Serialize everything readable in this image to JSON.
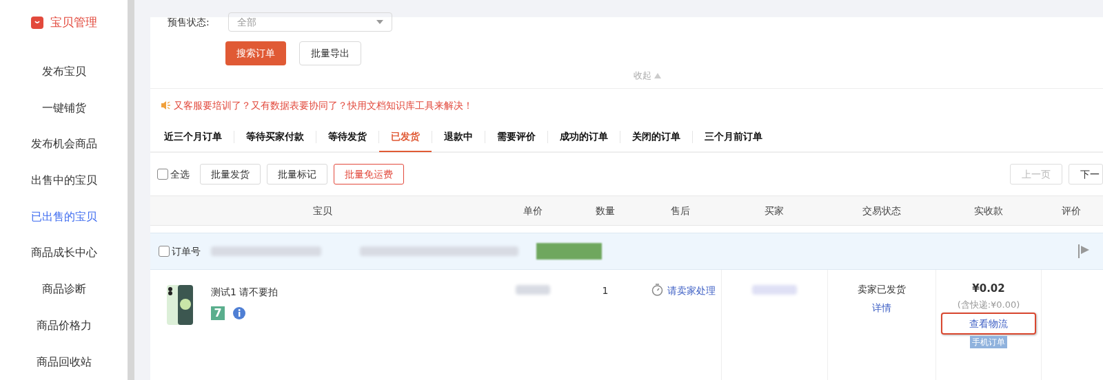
{
  "sidebar": {
    "header": "宝贝管理",
    "items": [
      {
        "label": "发布宝贝",
        "selected": false
      },
      {
        "label": "一键铺货",
        "selected": false
      },
      {
        "label": "发布机会商品",
        "selected": false
      },
      {
        "label": "出售中的宝贝",
        "selected": false
      },
      {
        "label": "已出售的宝贝",
        "selected": true
      },
      {
        "label": "商品成长中心",
        "selected": false
      },
      {
        "label": "商品诊断",
        "selected": false
      },
      {
        "label": "商品价格力",
        "selected": false
      },
      {
        "label": "商品回收站",
        "selected": false
      }
    ]
  },
  "filter": {
    "label": "预售状态:",
    "value": "全部"
  },
  "actions": [
    {
      "label": "搜索订单",
      "kind": "primary"
    },
    {
      "label": "批量导出",
      "kind": "default"
    }
  ],
  "collapse": "收起",
  "notice": "又客服要培训了？又有数据表要协同了？快用文档知识库工具来解决！",
  "tabs": [
    {
      "label": "近三个月订单",
      "selected": false
    },
    {
      "label": "等待买家付款",
      "selected": false
    },
    {
      "label": "等待发货",
      "selected": false
    },
    {
      "label": "已发货",
      "selected": true
    },
    {
      "label": "退款中",
      "selected": false
    },
    {
      "label": "需要评价",
      "selected": false
    },
    {
      "label": "成功的订单",
      "selected": false
    },
    {
      "label": "关闭的订单",
      "selected": false
    },
    {
      "label": "三个月前订单",
      "selected": false
    }
  ],
  "toolbar": {
    "select_all": {
      "label": "全选",
      "checked": false
    },
    "buttons": [
      {
        "label": "批量发货",
        "kind": "default"
      },
      {
        "label": "批量标记",
        "kind": "default"
      },
      {
        "label": "批量免运费",
        "kind": "danger"
      }
    ],
    "pagination": [
      {
        "label": "上一页",
        "disabled": true
      },
      {
        "label": "下一",
        "disabled": false
      }
    ]
  },
  "table": {
    "columns": [
      "宝贝",
      "单价",
      "数量",
      "售后",
      "买家",
      "交易状态",
      "实收款",
      "评价"
    ],
    "order": {
      "label": "订单号",
      "checked": false,
      "item": {
        "title": "测试1 请不要拍",
        "badge": "7",
        "quantity": "1",
        "after_sale": "请卖家处理",
        "status": "卖家已发货",
        "detail": "详情",
        "amount": "¥0.02",
        "shipping": "(含快递:¥0.00)",
        "logistics": "查看物流",
        "tag": "手机订单"
      }
    }
  }
}
